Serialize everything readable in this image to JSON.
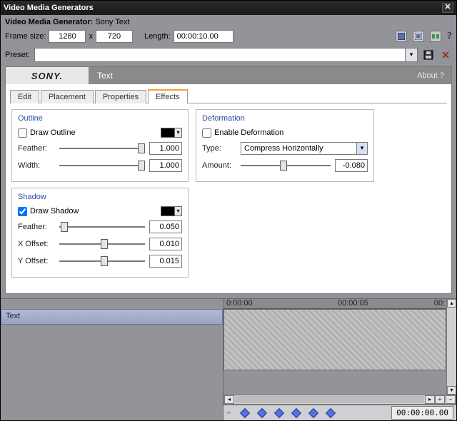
{
  "window": {
    "title": "Video Media Generators"
  },
  "header": {
    "label": "Video Media Generator:",
    "plugin": "Sony Text"
  },
  "frame": {
    "label": "Frame size:",
    "width": "1280",
    "x": "x",
    "height": "720",
    "length_label": "Length:",
    "length": "00:00:10.00"
  },
  "preset": {
    "label": "Preset:",
    "value": ""
  },
  "brand": {
    "logo": "SONY.",
    "title": "Text",
    "about": "About  ?"
  },
  "tabs": {
    "edit": "Edit",
    "placement": "Placement",
    "properties": "Properties",
    "effects": "Effects"
  },
  "outline": {
    "legend": "Outline",
    "draw_label": "Draw Outline",
    "draw_checked": false,
    "feather_label": "Feather:",
    "feather": "1.000",
    "width_label": "Width:",
    "width": "1.000"
  },
  "shadow": {
    "legend": "Shadow",
    "draw_label": "Draw Shadow",
    "draw_checked": true,
    "feather_label": "Feather:",
    "feather": "0.050",
    "xoff_label": "X Offset:",
    "xoff": "0.010",
    "yoff_label": "Y Offset:",
    "yoff": "0.015"
  },
  "deformation": {
    "legend": "Deformation",
    "enable_label": "Enable Deformation",
    "enable_checked": false,
    "type_label": "Type:",
    "type_value": "Compress Horizontally",
    "amount_label": "Amount:",
    "amount": "-0.080"
  },
  "timeline": {
    "track_label": "Text",
    "ruler": {
      "t0": "0:00:00",
      "t1": "00:00:05",
      "t2": "00:"
    },
    "timecode": "00:00:00.00"
  }
}
